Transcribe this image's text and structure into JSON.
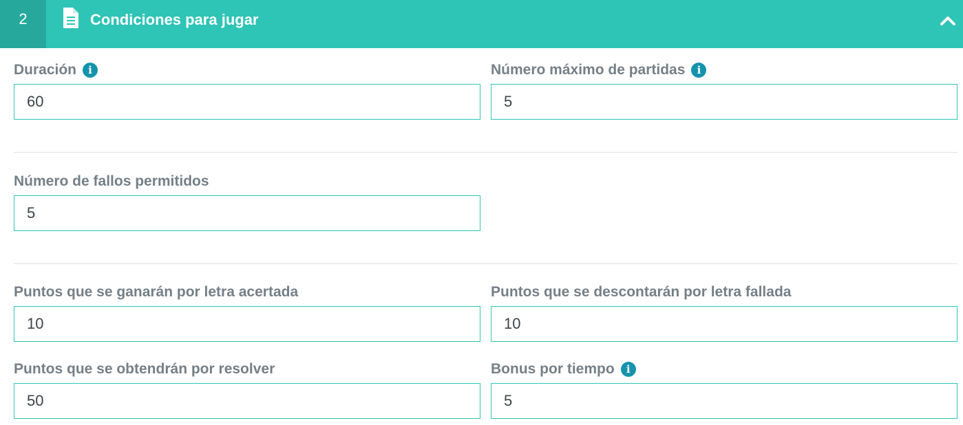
{
  "header": {
    "step_number": "2",
    "icon": "document-icon",
    "title": "Condiciones para jugar",
    "toggle_icon": "chevron-up-icon",
    "colors": {
      "bar": "#2ec4b6",
      "step_box": "#27a89c"
    }
  },
  "fields": {
    "duracion": {
      "label": "Duración",
      "value": "60",
      "has_info": true
    },
    "max_partidas": {
      "label": "Número máximo de partidas",
      "value": "5",
      "has_info": true
    },
    "fallos_permitidos": {
      "label": "Número de fallos permitidos",
      "value": "5",
      "has_info": false
    },
    "puntos_acierto": {
      "label": "Puntos que se ganarán por letra acertada",
      "value": "10",
      "has_info": false
    },
    "puntos_fallo": {
      "label": "Puntos que se descontarán por letra fallada",
      "value": "10",
      "has_info": false
    },
    "puntos_resolver": {
      "label": "Puntos que se obtendrán por resolver",
      "value": "50",
      "has_info": false
    },
    "bonus_tiempo": {
      "label": "Bonus por tiempo",
      "value": "5",
      "has_info": true
    }
  },
  "info_icon": {
    "glyph": "i",
    "name": "info-icon",
    "color": "#1593ad"
  },
  "accent_color": "#2ec4b6"
}
